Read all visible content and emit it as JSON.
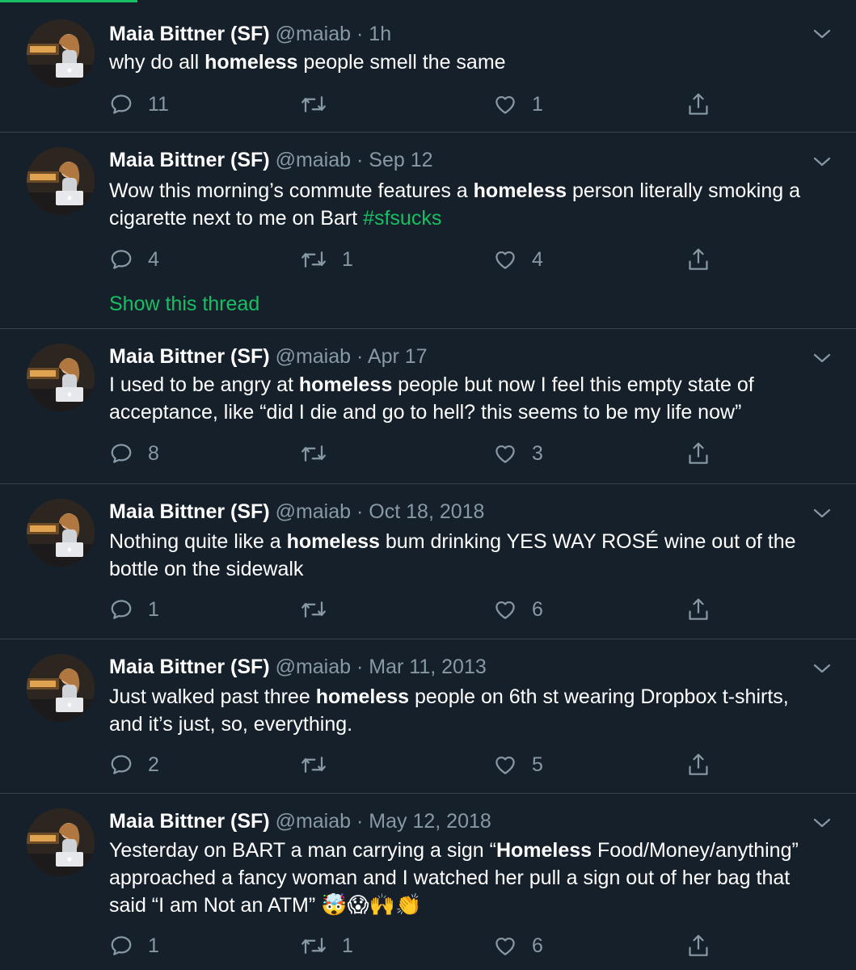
{
  "colors": {
    "background": "#15202b",
    "accent": "#17bf63",
    "muted": "#8899a6",
    "divider": "#38444d"
  },
  "tweets": [
    {
      "name": "Maia Bittner (SF)",
      "handle": "@maiab",
      "time": "1h",
      "text": [
        {
          "t": "why do all "
        },
        {
          "b": "homeless"
        },
        {
          "t": " people smell the same"
        }
      ],
      "replies": "11",
      "retweets": "",
      "likes": "1"
    },
    {
      "name": "Maia Bittner (SF)",
      "handle": "@maiab",
      "time": "Sep 12",
      "text": [
        {
          "t": "Wow this morning’s commute features a "
        },
        {
          "b": "homeless"
        },
        {
          "t": " person literally smoking a cigarette next to me on Bart "
        },
        {
          "h": "#sfsucks"
        }
      ],
      "replies": "4",
      "retweets": "1",
      "likes": "4",
      "show_thread": "Show this thread"
    },
    {
      "name": "Maia Bittner (SF)",
      "handle": "@maiab",
      "time": "Apr 17",
      "text": [
        {
          "t": "I used to be angry at "
        },
        {
          "b": "homeless"
        },
        {
          "t": " people but now I feel this empty state of acceptance, like “did I die and go to hell? this seems to be my life now”"
        }
      ],
      "replies": "8",
      "retweets": "",
      "likes": "3"
    },
    {
      "name": "Maia Bittner (SF)",
      "handle": "@maiab",
      "time": "Oct 18, 2018",
      "text": [
        {
          "t": "Nothing quite like a "
        },
        {
          "b": "homeless"
        },
        {
          "t": " bum drinking YES WAY ROSÉ wine out of the bottle on the sidewalk"
        }
      ],
      "replies": "1",
      "retweets": "",
      "likes": "6"
    },
    {
      "name": "Maia Bittner (SF)",
      "handle": "@maiab",
      "time": "Mar 11, 2013",
      "text": [
        {
          "t": "Just walked past three "
        },
        {
          "b": "homeless"
        },
        {
          "t": " people on 6th st wearing Dropbox t-shirts, and it’s just, so, everything."
        }
      ],
      "replies": "2",
      "retweets": "",
      "likes": "5"
    },
    {
      "name": "Maia Bittner (SF)",
      "handle": "@maiab",
      "time": "May 12, 2018",
      "text": [
        {
          "t": "Yesterday on BART a man carrying a sign “"
        },
        {
          "b": "Homeless"
        },
        {
          "t": " Food/Money/anything” approached a fancy woman and I watched her pull a sign out of her bag that said “I am Not an ATM” "
        },
        {
          "e": "🤯😱🙌👏"
        }
      ],
      "replies": "1",
      "retweets": "1",
      "likes": "6"
    }
  ],
  "icons": {
    "caret": "chevron-down-icon",
    "reply": "reply-icon",
    "retweet": "retweet-icon",
    "like": "heart-icon",
    "share": "share-icon"
  }
}
